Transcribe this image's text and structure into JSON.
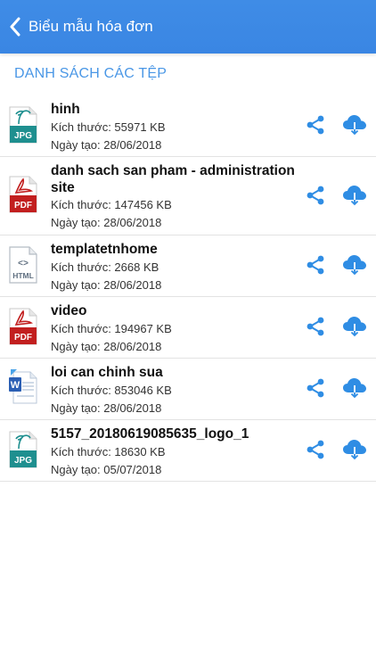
{
  "navbar": {
    "back_icon": "chevron-left-icon",
    "title": "Biểu mẫu hóa đơn",
    "color": "#3a86e3"
  },
  "section_header": "DANH SÁCH CÁC TỆP",
  "accent_color": "#4a97e6",
  "files": [
    {
      "type": "JPG",
      "name": "hinh",
      "size": "Kích thước: 55971 KB",
      "date": "Ngày tạo: 28/06/2018"
    },
    {
      "type": "PDF",
      "name": "danh sach san pham - administration site",
      "size": "Kích thước: 147456 KB",
      "date": "Ngày tạo: 28/06/2018"
    },
    {
      "type": "HTML",
      "name": "templatetnhome",
      "size": "Kích thước: 2668 KB",
      "date": "Ngày tạo: 28/06/2018"
    },
    {
      "type": "PDF",
      "name": "video",
      "size": "Kích thước: 194967 KB",
      "date": "Ngày tạo: 28/06/2018"
    },
    {
      "type": "DOC",
      "name": "loi can chinh sua",
      "size": "Kích thước: 853046 KB",
      "date": "Ngày tạo: 28/06/2018"
    },
    {
      "type": "JPG",
      "name": "5157_20180619085635_logo_1",
      "size": "Kích thước: 18630 KB",
      "date": "Ngày tạo: 05/07/2018"
    }
  ],
  "icons": {
    "share": "share-icon",
    "download": "cloud-download-icon"
  }
}
